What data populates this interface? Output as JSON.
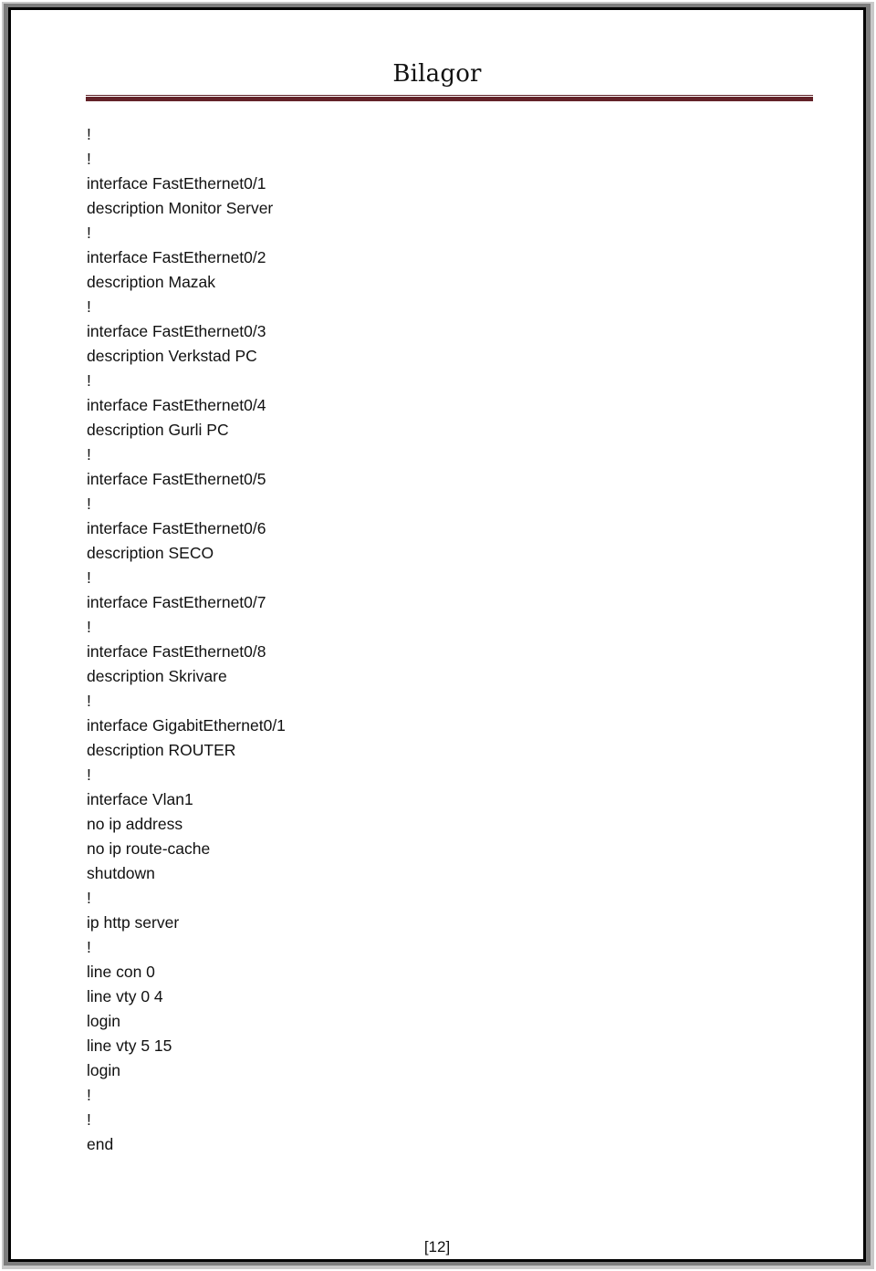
{
  "document": {
    "header": {
      "title": "Bilagor",
      "rule_color": "#632329"
    },
    "config_lines": [
      "!",
      "!",
      "interface FastEthernet0/1",
      "description Monitor Server",
      "!",
      "interface FastEthernet0/2",
      "description Mazak",
      "!",
      "interface FastEthernet0/3",
      "description Verkstad PC",
      "!",
      "interface FastEthernet0/4",
      "description Gurli PC",
      "!",
      "interface FastEthernet0/5",
      "!",
      "interface FastEthernet0/6",
      "description SECO",
      "!",
      "interface FastEthernet0/7",
      "!",
      "interface FastEthernet0/8",
      "description Skrivare",
      "!",
      "interface GigabitEthernet0/1",
      "description ROUTER",
      "!",
      "interface Vlan1",
      "no ip address",
      "no ip route-cache",
      "shutdown",
      "!",
      "ip http server",
      "!",
      "line con 0",
      "line vty 0 4",
      "login",
      "line vty 5 15",
      "login",
      "!",
      "!",
      "end"
    ],
    "footer": {
      "page_number": "[12]"
    }
  }
}
